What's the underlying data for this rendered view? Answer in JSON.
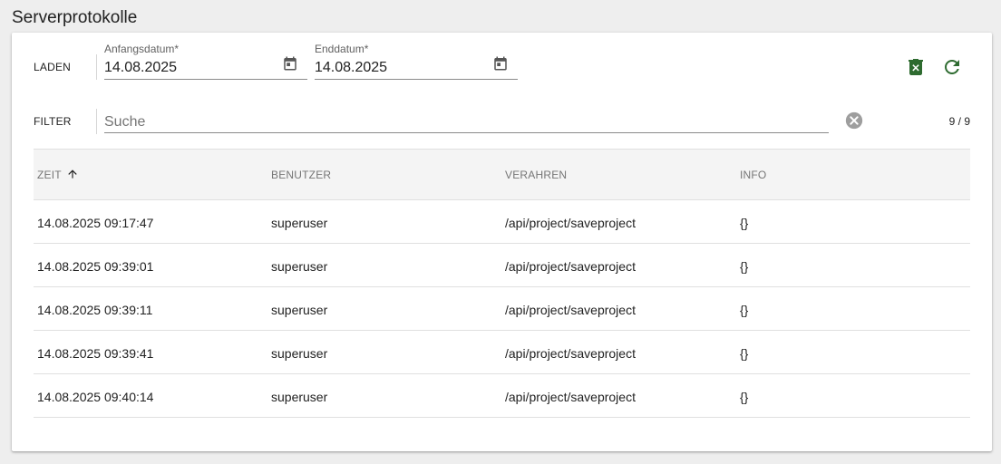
{
  "page": {
    "title": "Serverprotokolle"
  },
  "load": {
    "label": "LADEN",
    "start_date": {
      "label": "Anfangsdatum*",
      "value": "14.08.2025",
      "icon": "calendar-icon"
    },
    "end_date": {
      "label": "Enddatum*",
      "value": "14.08.2025",
      "icon": "calendar-icon"
    },
    "delete_icon": "delete-icon",
    "refresh_icon": "refresh-icon",
    "icon_color": "#2e6b30"
  },
  "filter": {
    "label": "FILTER",
    "placeholder": "Suche",
    "value": "",
    "clear_icon": "clear-circle-icon",
    "count": "9 / 9"
  },
  "table": {
    "columns": [
      "ZEIT",
      "BENUTZER",
      "VERAHREN",
      "INFO"
    ],
    "sort": {
      "column": "ZEIT",
      "direction": "ascending",
      "icon": "arrow-up-icon"
    },
    "rows": [
      {
        "time": "14.08.2025 09:17:47",
        "user": "superuser",
        "method": "/api/project/saveproject",
        "info": "{}"
      },
      {
        "time": "14.08.2025 09:39:01",
        "user": "superuser",
        "method": "/api/project/saveproject",
        "info": "{}"
      },
      {
        "time": "14.08.2025 09:39:11",
        "user": "superuser",
        "method": "/api/project/saveproject",
        "info": "{}"
      },
      {
        "time": "14.08.2025 09:39:41",
        "user": "superuser",
        "method": "/api/project/saveproject",
        "info": "{}"
      },
      {
        "time": "14.08.2025 09:40:14",
        "user": "superuser",
        "method": "/api/project/saveproject",
        "info": "{}"
      }
    ]
  }
}
